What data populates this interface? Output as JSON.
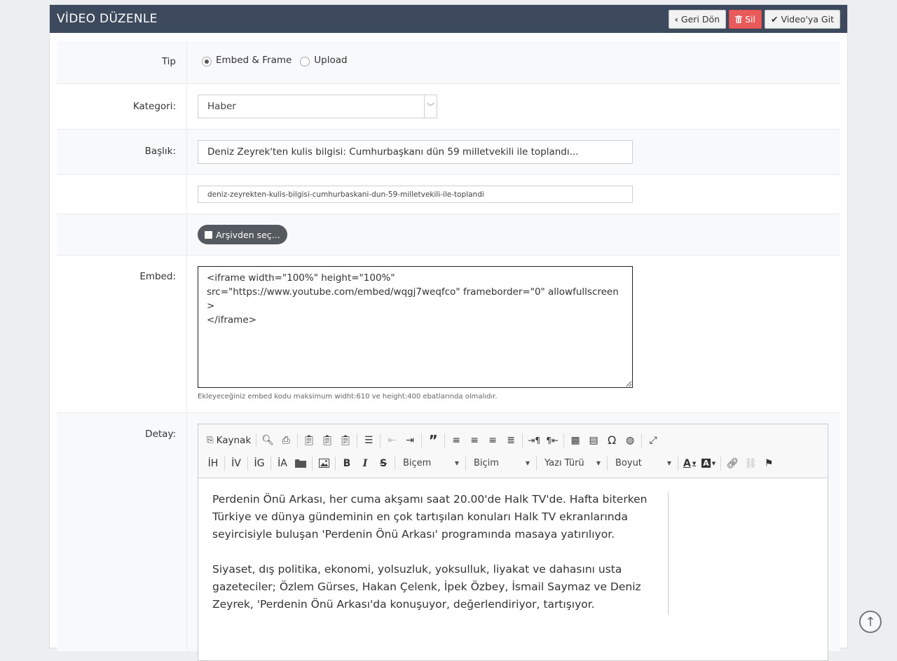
{
  "header": {
    "title": "VİDEO DÜZENLE",
    "back_label": "Geri Dön",
    "delete_label": "Sil",
    "goto_label": "Video'ya Git"
  },
  "form": {
    "type_label": "Tip",
    "type_options": [
      "Embed & Frame",
      "Upload"
    ],
    "type_selected": "Embed & Frame",
    "category_label": "Kategori:",
    "category_value": "Haber",
    "title_label": "Başlık:",
    "title_value": "Deniz Zeyrek'ten kulis bilgisi: Cumhurbaşkanı dün 59 milletvekili ile toplandı...",
    "slug_value": "deniz-zeyrekten-kulis-bilgisi-cumhurbaskani-dun-59-milletvekili-ile-toplandi",
    "archive_label": "Arşivden seç...",
    "embed_label": "Embed:",
    "embed_value": "<iframe width=\"100%\" height=\"100%\"\nsrc=\"https://www.youtube.com/embed/wqgj7weqfco\" frameborder=\"0\" allowfullscreen>\n</iframe>",
    "embed_hint": "Ekleyeceğiniz embed kodu maksimum widht:610 ve height:400 ebatlarında olmalıdır.",
    "detail_label": "Detay:"
  },
  "editor": {
    "source_label": "Kaynak",
    "heading_buttons": [
      "İH",
      "İV",
      "İG",
      "İA"
    ],
    "format_combos": [
      "Biçem",
      "Biçim",
      "Yazı Türü",
      "Boyut"
    ],
    "paragraphs": [
      "Perdenin Önü Arkası, her cuma akşamı saat 20.00'de Halk TV'de. Hafta biterken Türkiye ve dünya gündeminin en çok tartışılan konuları Halk TV ekranlarında seyircisiyle buluşan 'Perdenin Önü Arkası' programında masaya yatırılıyor.",
      "Siyaset, dış politika, ekonomi, yolsuzluk, yoksulluk, liyakat ve dahasını usta gazeteciler; Özlem Gürses, Hakan Çelenk, İpek Özbey, İsmail Saymaz ve Deniz Zeyrek, 'Perdenin Önü Arkası'da konuşuyor, değerlendiriyor, tartışıyor."
    ]
  }
}
